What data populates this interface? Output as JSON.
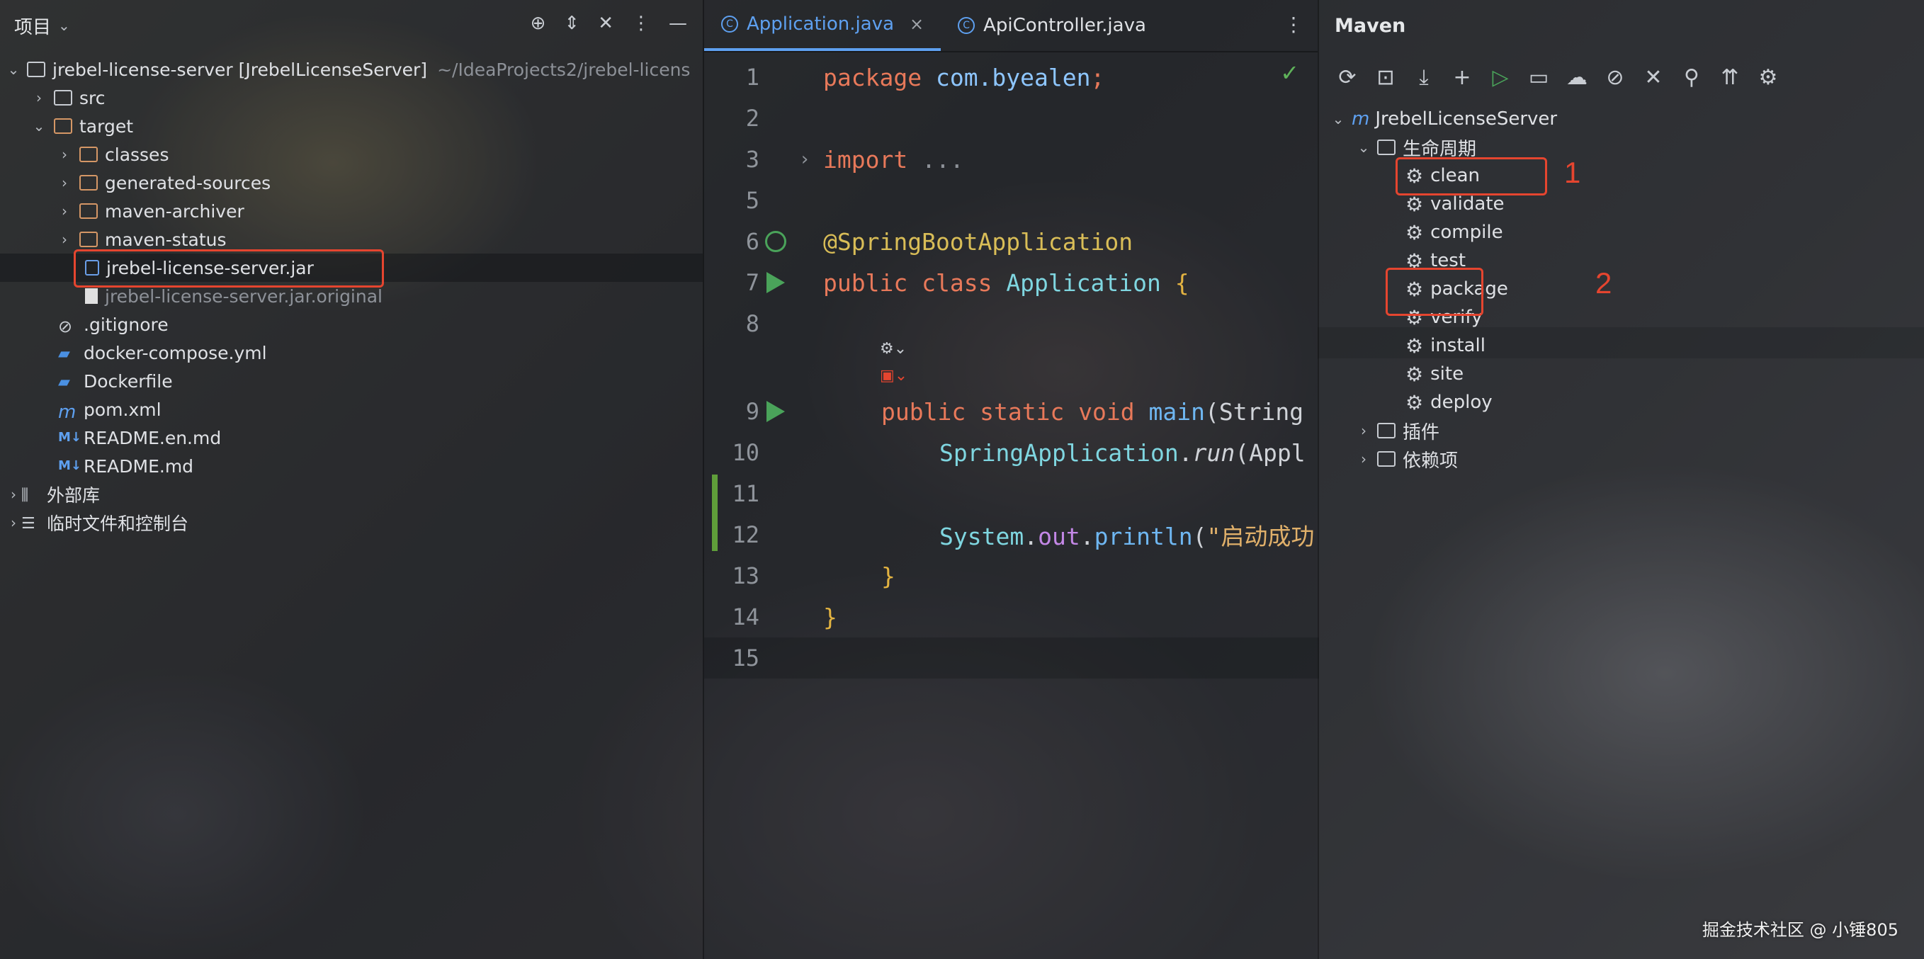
{
  "project": {
    "title": "项目",
    "tree": [
      {
        "label": "jrebel-license-server [JrebelLicenseServer]",
        "path": "~/IdeaProjects2/jrebel-licens"
      },
      {
        "label": "src"
      },
      {
        "label": "target"
      },
      {
        "label": "classes"
      },
      {
        "label": "generated-sources"
      },
      {
        "label": "maven-archiver"
      },
      {
        "label": "maven-status"
      },
      {
        "label": "jrebel-license-server.jar"
      },
      {
        "label": "jrebel-license-server.jar.original"
      },
      {
        "label": ".gitignore"
      },
      {
        "label": "docker-compose.yml"
      },
      {
        "label": "Dockerfile"
      },
      {
        "label": "pom.xml"
      },
      {
        "label": "README.en.md"
      },
      {
        "label": "README.md"
      },
      {
        "label": "外部库"
      },
      {
        "label": "临时文件和控制台"
      }
    ]
  },
  "editor": {
    "tabs": [
      {
        "label": "Application.java",
        "active": true
      },
      {
        "label": "ApiController.java",
        "active": false
      }
    ],
    "lines": [
      {
        "n": "1",
        "t": "package com.byealen;"
      },
      {
        "n": "2",
        "t": ""
      },
      {
        "n": "3",
        "t": "import ..."
      },
      {
        "n": "5",
        "t": ""
      },
      {
        "n": "6",
        "t": "@SpringBootApplication"
      },
      {
        "n": "7",
        "t": "public class Application {"
      },
      {
        "n": "8",
        "t": ""
      },
      {
        "n": "9",
        "t": "    public static void main(String"
      },
      {
        "n": "10",
        "t": "        SpringApplication.run(Appl"
      },
      {
        "n": "11",
        "t": ""
      },
      {
        "n": "12",
        "t": "        System.out.println(\"启动成功"
      },
      {
        "n": "13",
        "t": "    }"
      },
      {
        "n": "14",
        "t": "}"
      },
      {
        "n": "15",
        "t": ""
      }
    ],
    "tokens": {
      "package": "package",
      "pkgname": "com.byealen",
      "semi": ";",
      "import": "import",
      "ellipsis": "...",
      "annotation": "@SpringBootApplication",
      "public": "public",
      "class": "class",
      "classname": "Application",
      "open": "{",
      "static": "static",
      "void": "void",
      "main": "main",
      "mainargs": "(String",
      "springapp": "SpringApplication",
      "dot": ".",
      "run": "run",
      "runargs": "(Appl",
      "system": "System",
      "out": "out",
      "println": "println",
      "paren": "(",
      "str": "\"启动成功",
      "close": "}"
    }
  },
  "maven": {
    "title": "Maven",
    "project": "JrebelLicenseServer",
    "lifecycle": "生命周期",
    "goals": [
      "clean",
      "validate",
      "compile",
      "test",
      "package",
      "verify",
      "install",
      "site",
      "deploy"
    ],
    "plugins": "插件",
    "dependencies": "依赖项",
    "markers": [
      "1",
      "2"
    ]
  },
  "watermark": "掘金技术社区 @ 小锤805",
  "colors": {
    "highlight": "#e5452f",
    "accent": "#5ea0f0",
    "run": "#4aa35a"
  }
}
